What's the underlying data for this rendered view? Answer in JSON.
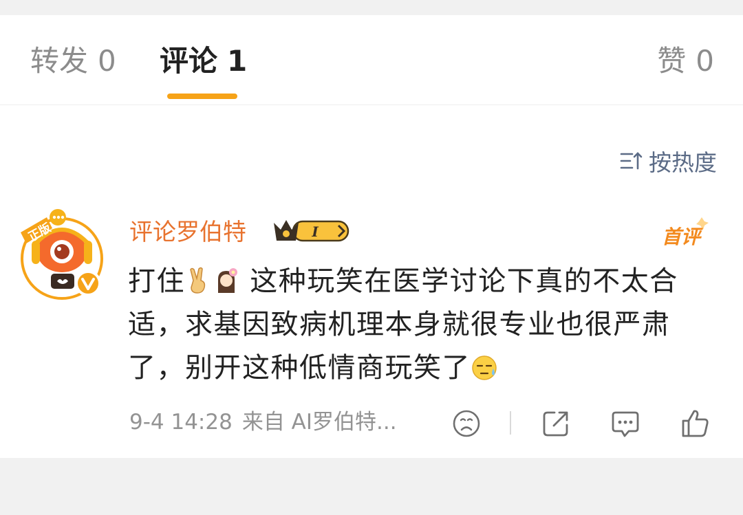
{
  "tabs": [
    {
      "label": "转发",
      "count": "0"
    },
    {
      "label": "评论",
      "count": "1"
    },
    {
      "label": "赞",
      "count": "0"
    }
  ],
  "sort": {
    "label": "按热度"
  },
  "comment": {
    "username": "评论罗伯特",
    "badge_level": "I",
    "first_tag": "首评",
    "text_part1": "打住",
    "text_part2": " 这种玩笑在医学讨论下真的不太合适，求基因致病机理本身就很专业也很严肃了，别开这种低情商玩笑了",
    "avatar_text": "正版",
    "time": "9-4 14:28",
    "source": "来自 AI罗伯特..."
  },
  "colors": {
    "accent": "#f6a318",
    "username": "#e8732f",
    "sort": "#5b6b86",
    "meta": "#939393"
  },
  "icons": {
    "sort": "sort-icon",
    "dislike": "frown-icon",
    "share": "share-icon",
    "reply": "comment-icon",
    "like": "thumbs-up-icon"
  }
}
